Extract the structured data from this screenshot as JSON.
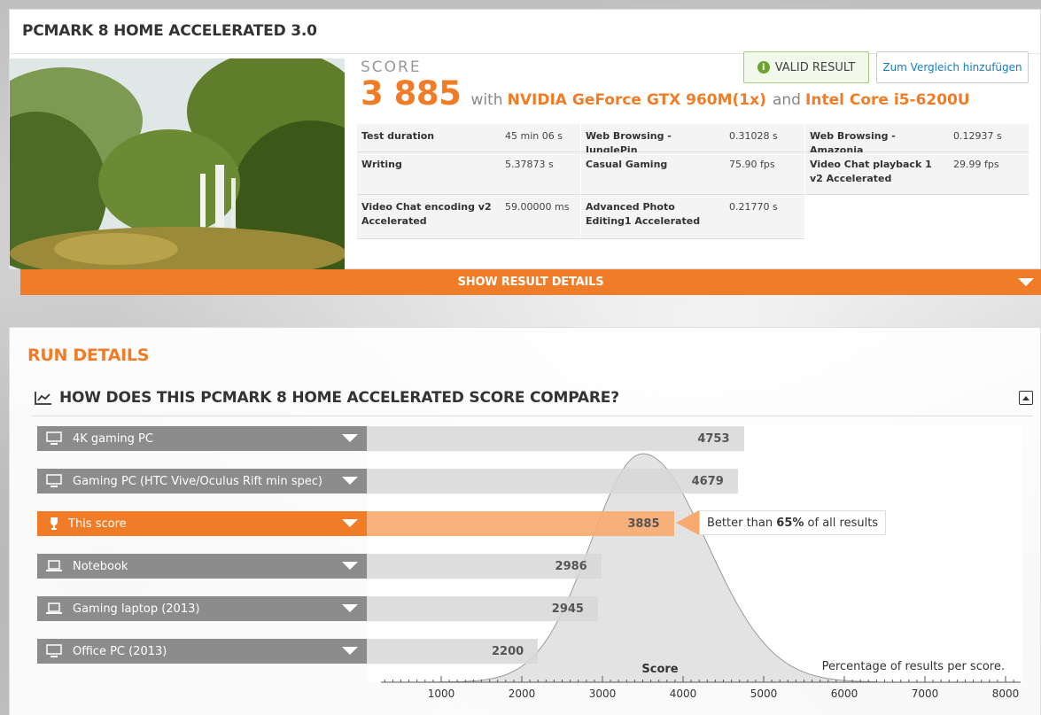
{
  "result": {
    "title": "PCMARK 8 HOME ACCELERATED 3.0",
    "score_label": "SCORE",
    "score_value": "3 885",
    "with_text": "with",
    "gpu": "NVIDIA GeForce GTX 960M(1x)",
    "and_text": "and",
    "cpu": "Intel Core i5-6200U",
    "valid_label": "VALID RESULT",
    "compare_label": "Zum Vergleich hinzufügen",
    "metrics": [
      {
        "label": "Test duration",
        "value": "45 min 06 s"
      },
      {
        "label": "Web Browsing - JunglePin",
        "value": "0.31028 s"
      },
      {
        "label": "Web Browsing - Amazonia",
        "value": "0.12937 s"
      },
      {
        "label": "Writing",
        "value": "5.37873 s"
      },
      {
        "label": "Casual Gaming",
        "value": "75.90 fps"
      },
      {
        "label": "Video Chat playback 1 v2 Accelerated",
        "value": "29.99 fps"
      },
      {
        "label": "Video Chat encoding v2 Accelerated",
        "value": "59.00000 ms"
      },
      {
        "label": "Advanced Photo Editing1 Accelerated",
        "value": "0.21770 s"
      }
    ],
    "show_details_label": "SHOW RESULT DETAILS"
  },
  "run": {
    "title": "RUN DETAILS",
    "compare_title": "HOW DOES THIS PCMARK 8 HOME ACCELERATED SCORE COMPARE?",
    "better_prefix": "Better than",
    "better_percent": "65%",
    "better_suffix": "of all results",
    "score_axis_label": "Score",
    "distribution_label": "Percentage of results per score."
  },
  "chart_data": {
    "type": "bar",
    "categories": [
      "4K gaming PC",
      "Gaming PC (HTC Vive/Oculus Rift min spec)",
      "This score",
      "Notebook",
      "Gaming laptop (2013)",
      "Office PC (2013)"
    ],
    "values": [
      4753,
      4679,
      3885,
      2986,
      2945,
      2200
    ],
    "highlight_index": 2,
    "xlabel": "Score",
    "xlim": [
      0,
      8000
    ],
    "xticks": [
      1000,
      2000,
      3000,
      4000,
      5000,
      6000,
      7000,
      8000
    ],
    "distribution_peak": 3500,
    "colors": {
      "accent": "#f07c27",
      "bar": "#8c8c8c",
      "fill": "#d7d7d7",
      "highlight_fill": "#f9aa6e"
    }
  }
}
